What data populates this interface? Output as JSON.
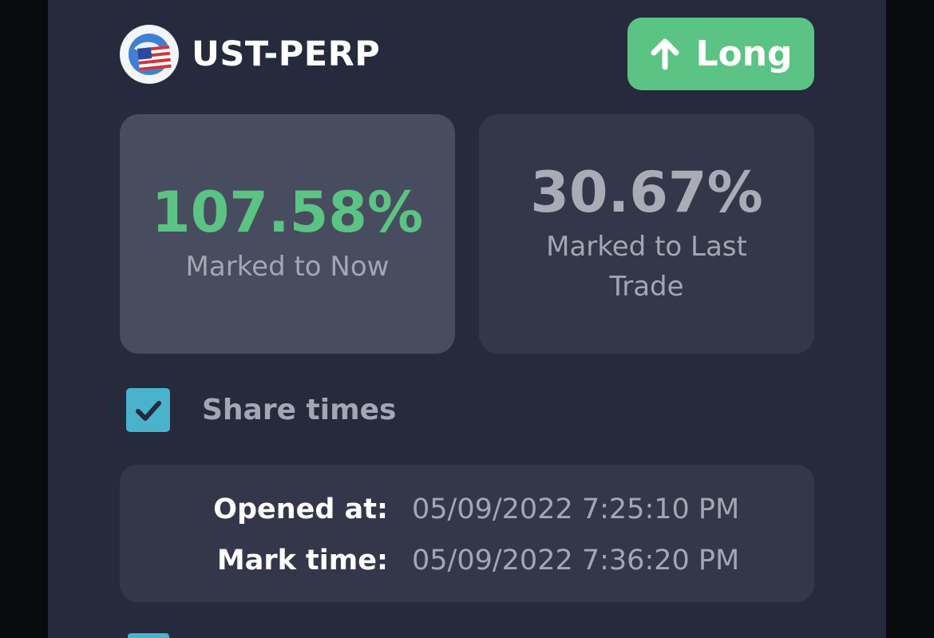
{
  "market": {
    "name": "UST-PERP",
    "logo_icon": "us-flag-globe-icon"
  },
  "position": {
    "side_label": "Long",
    "side_icon": "arrow-up-icon",
    "side_color": "#5bc383"
  },
  "pnl": {
    "marked_to_now": {
      "value": "107.58%",
      "caption": "Marked to Now",
      "color": "#5bc383"
    },
    "marked_to_last_trade": {
      "value": "30.67%",
      "caption": "Marked to Last Trade",
      "color": "#a9abb6"
    }
  },
  "share_times": {
    "label": "Share times",
    "checked": true,
    "checkbox_color": "#4ab3cc"
  },
  "times": {
    "opened_label": "Opened at:",
    "opened_value": "05/09/2022 7:25:10 PM",
    "mark_label": "Mark time:",
    "mark_value": "05/09/2022 7:36:20 PM"
  }
}
